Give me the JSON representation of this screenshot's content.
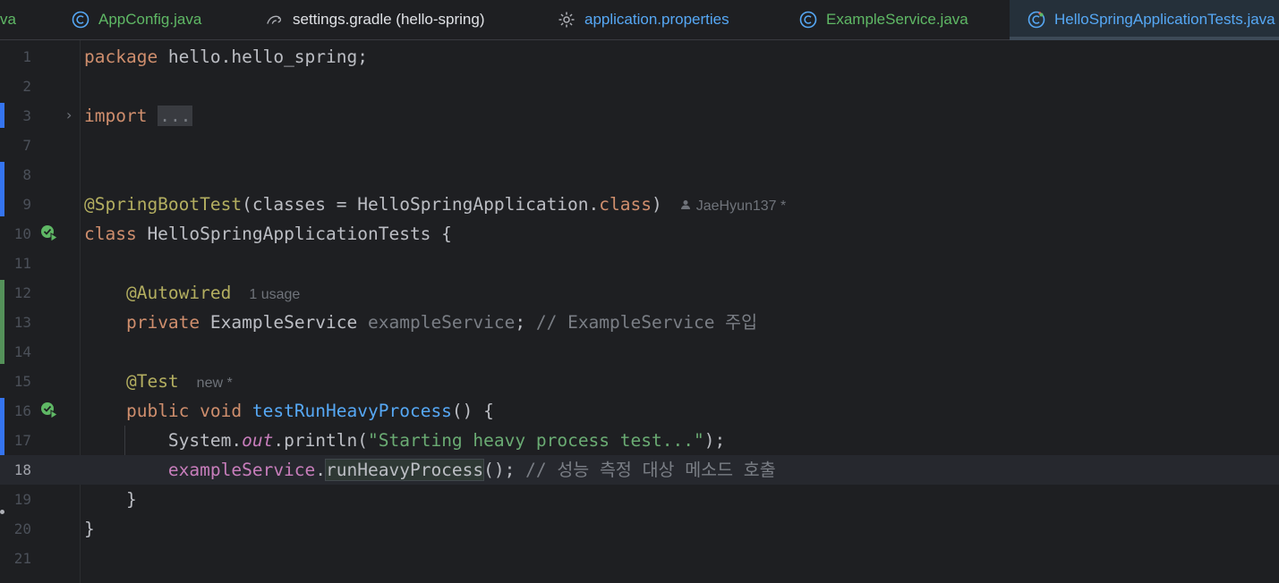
{
  "tabs": [
    {
      "label": "va",
      "color": "#5fb865",
      "icon": "none"
    },
    {
      "label": "AppConfig.java",
      "color": "#5fb865",
      "icon": "class-icon"
    },
    {
      "label": "settings.gradle (hello-spring)",
      "color": "#dfe1e5",
      "icon": "gradle-icon"
    },
    {
      "label": "application.properties",
      "color": "#56a8f5",
      "icon": "gear-icon"
    },
    {
      "label": "ExampleService.java",
      "color": "#5fb865",
      "icon": "class-icon"
    },
    {
      "label": "HelloSpringApplicationTests.java",
      "color": "#56a8f5",
      "icon": "test-class-icon",
      "active": true
    }
  ],
  "line_numbers": [
    "1",
    "2",
    "3",
    "7",
    "8",
    "9",
    "10",
    "11",
    "12",
    "13",
    "14",
    "15",
    "16",
    "17",
    "18",
    "19",
    "20",
    "21"
  ],
  "current_line": "18",
  "code": {
    "l1_kw": "package",
    "l1_rest": " hello.hello_spring;",
    "l3_kw": "import",
    "l3_fold": "...",
    "l9_ann": "@SpringBootTest",
    "l9_rest": "(classes = HelloSpringApplication.",
    "l9_kw": "class",
    "l9_close": ")",
    "l9_hint": "JaeHyun137 *",
    "l10_kw": "class",
    "l10_rest": " HelloSpringApplicationTests {",
    "l12_ann": "@Autowired",
    "l12_hint": "1 usage",
    "l13_kw": "private",
    "l13_type": " ExampleService ",
    "l13_field": "exampleService",
    "l13_semi": "; ",
    "l13_cmt": "// ExampleService 주입",
    "l15_ann": "@Test",
    "l15_hint": "new *",
    "l16_kw": "public void",
    "l16_sp": " ",
    "l16_mth": "testRunHeavyProcess",
    "l16_rest": "() {",
    "l17_sys": "System.",
    "l17_out": "out",
    "l17_print": ".println(",
    "l17_str": "\"Starting heavy process test...\"",
    "l17_end": ");",
    "l18_fld": "exampleService",
    "l18_dot": ".",
    "l18_call": "runHeavyProcess",
    "l18_end": "(); ",
    "l18_cmt": "// 성능 측정 대상 메소드 호출",
    "l19": "}",
    "l20": "}"
  },
  "colors": {
    "background": "#1e1f22",
    "keyword": "#cf8e6d",
    "annotation": "#b3ae60",
    "string": "#6aab73",
    "comment": "#7a7e85",
    "field": "#c77dbb",
    "method": "#56a8f5"
  }
}
